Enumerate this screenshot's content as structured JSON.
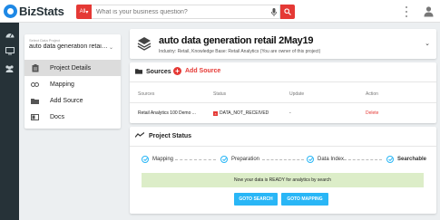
{
  "app": {
    "brand": "BizStats"
  },
  "search": {
    "scope_label": "All",
    "placeholder": "What is your business question?"
  },
  "sidebar": {
    "icons": [
      "dashboard-icon",
      "monitor-icon",
      "users-icon"
    ]
  },
  "project_selector": {
    "label": "Select Data Project",
    "value": "auto data generation retai…"
  },
  "menu": {
    "items": [
      {
        "label": "Project Details",
        "icon": "clipboard-icon",
        "active": true
      },
      {
        "label": "Mapping",
        "icon": "link-icon",
        "active": false
      },
      {
        "label": "Add Source",
        "icon": "folder-icon",
        "active": false
      },
      {
        "label": "Docs",
        "icon": "docs-icon",
        "active": false
      }
    ]
  },
  "project": {
    "title": "auto data generation retail 2May19",
    "subtitle": "Industry: Retail, Knowledge Base: Retail Analytics (You are owner of this project)"
  },
  "sources": {
    "heading": "Sources",
    "add_label": "Add Source",
    "columns": [
      "Sources",
      "Status",
      "Update",
      "Action"
    ],
    "rows": [
      {
        "source": "Retail Analytics 100 Demo ...",
        "status": "DATA_NOT_RECEIVED",
        "update": "-",
        "action": "Delete"
      }
    ]
  },
  "project_status": {
    "heading": "Project Status",
    "steps": [
      "Mapping",
      "Preparation",
      "Data Index",
      "Searchable"
    ],
    "ready_message": "Now your data is READY for analytics by search",
    "buttons": {
      "search": "GOTO SEARCH",
      "mapping": "GOTO MAPPING"
    }
  },
  "colors": {
    "accent": "#e53935",
    "primary": "#29b6f6",
    "sidebar": "#263238",
    "ready_bg": "#dcedc8"
  }
}
